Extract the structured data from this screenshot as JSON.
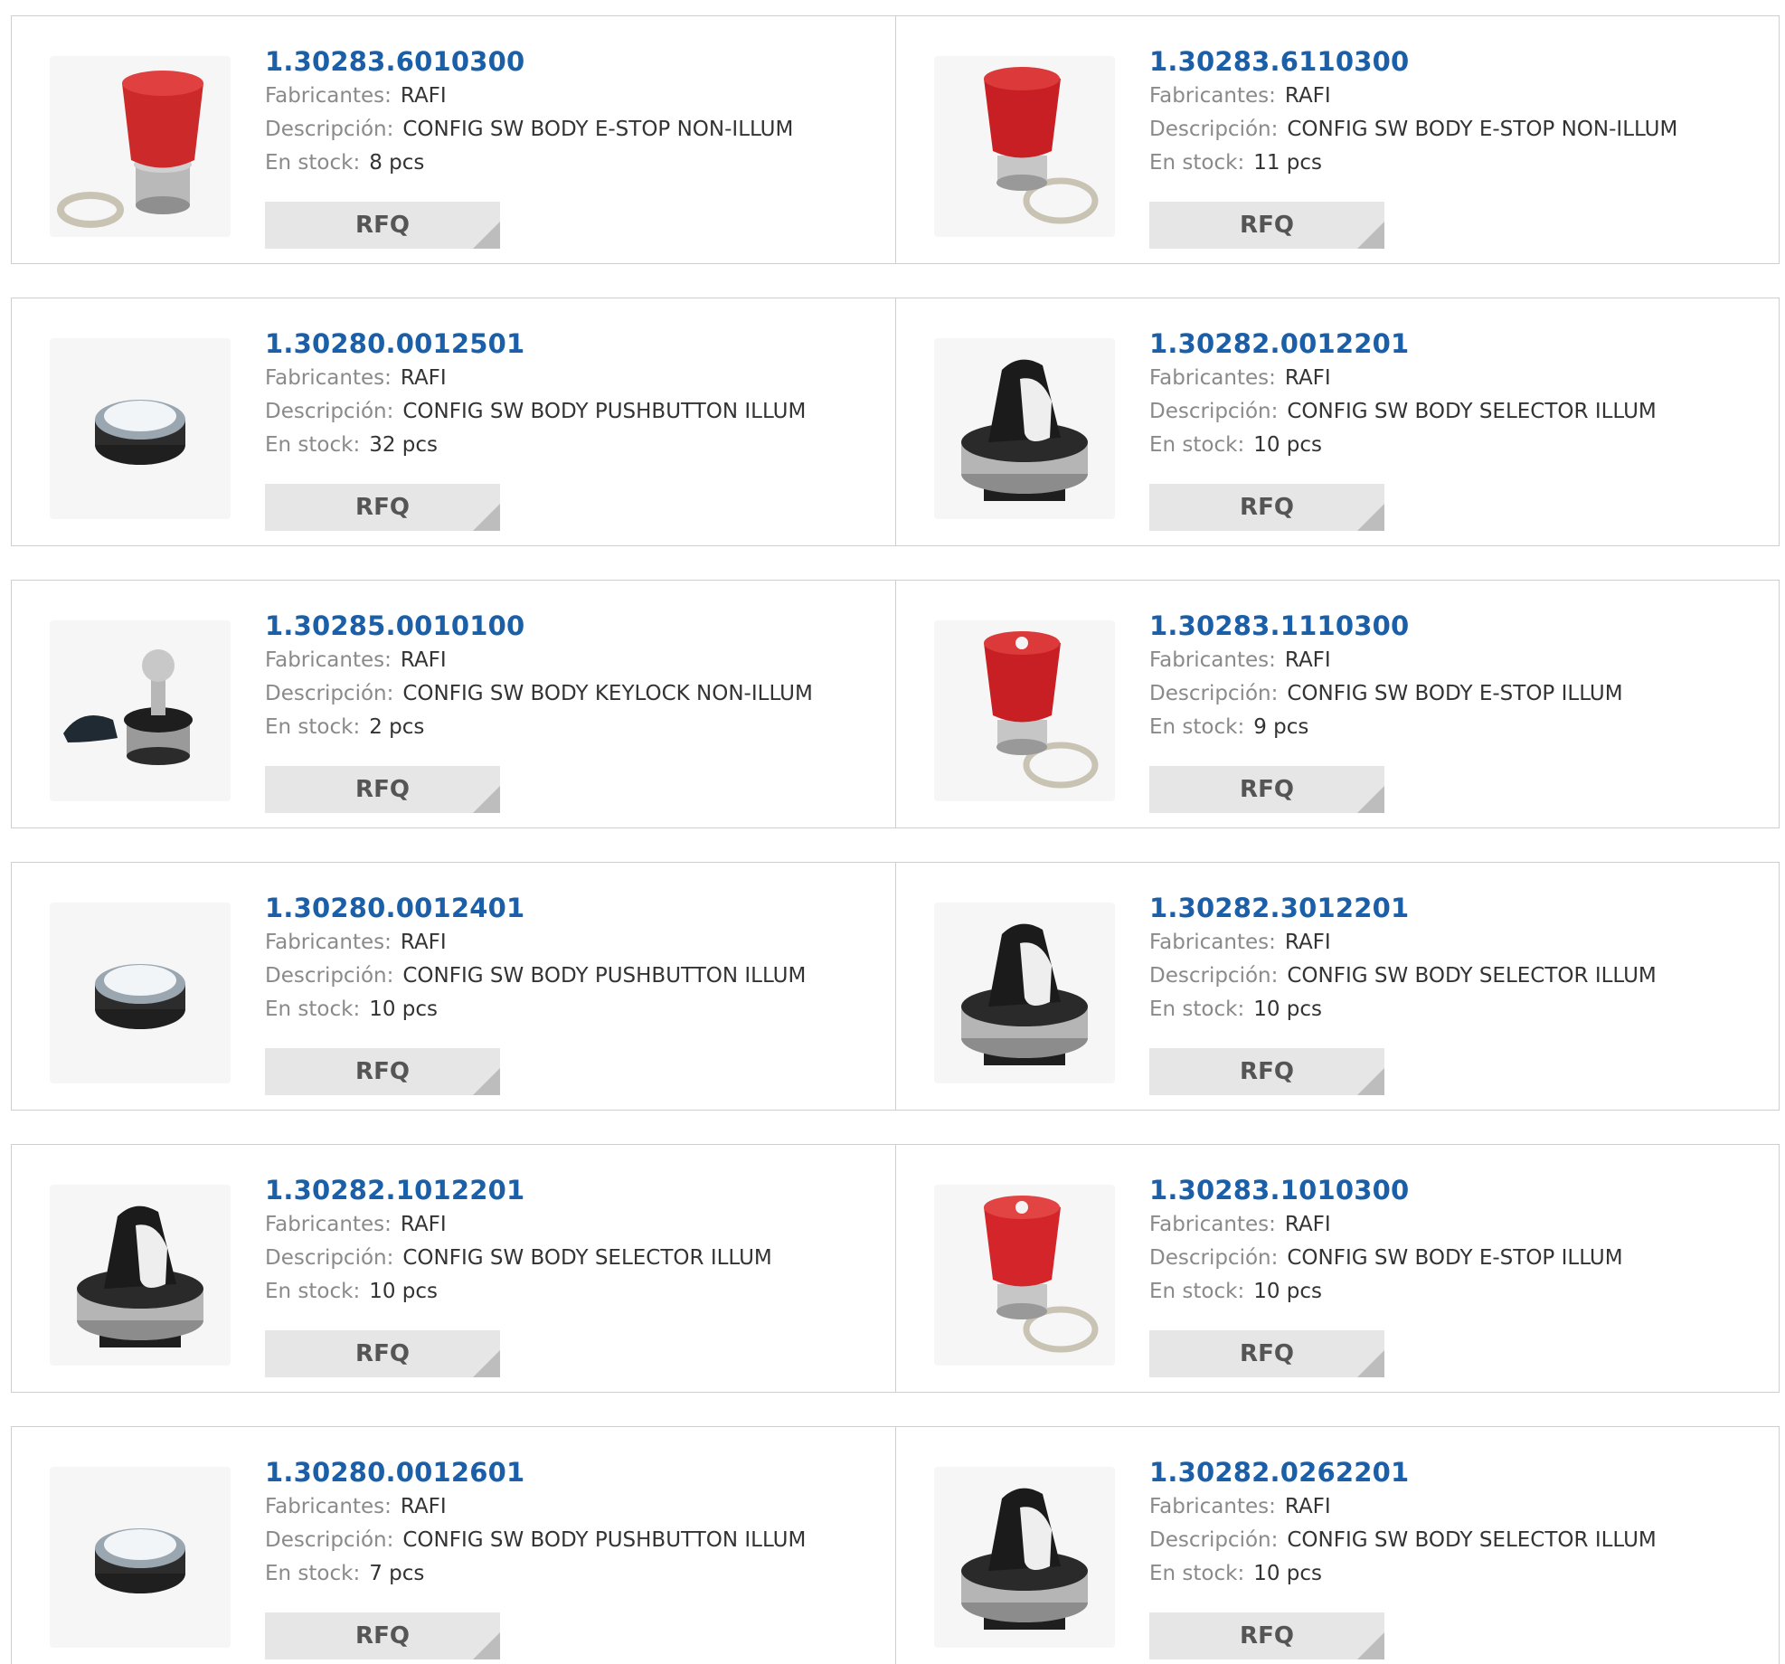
{
  "labels": {
    "manufacturer": "Fabricantes:",
    "description": "Descripción:",
    "stock": "En stock:",
    "rfq": "RFQ"
  },
  "products": [
    {
      "part": "1.30283.6010300",
      "manufacturer": "RAFI",
      "description": "CONFIG SW BODY E-STOP NON-ILLUM",
      "stock": "8 pcs",
      "image": "red-estop-button-icon"
    },
    {
      "part": "1.30283.6110300",
      "manufacturer": "RAFI",
      "description": "CONFIG SW BODY E-STOP NON-ILLUM",
      "stock": "11 pcs",
      "image": "red-estop-button-icon"
    },
    {
      "part": "1.30280.0012501",
      "manufacturer": "RAFI",
      "description": "CONFIG SW BODY PUSHBUTTON ILLUM",
      "stock": "32 pcs",
      "image": "pushbutton-icon"
    },
    {
      "part": "1.30282.0012201",
      "manufacturer": "RAFI",
      "description": "CONFIG SW BODY SELECTOR ILLUM",
      "stock": "10 pcs",
      "image": "selector-switch-icon"
    },
    {
      "part": "1.30285.0010100",
      "manufacturer": "RAFI",
      "description": "CONFIG SW BODY KEYLOCK NON-ILLUM",
      "stock": "2 pcs",
      "image": "keylock-switch-icon"
    },
    {
      "part": "1.30283.1110300",
      "manufacturer": "RAFI",
      "description": "CONFIG SW BODY E-STOP ILLUM",
      "stock": "9 pcs",
      "image": "red-estop-button-icon"
    },
    {
      "part": "1.30280.0012401",
      "manufacturer": "RAFI",
      "description": "CONFIG SW BODY PUSHBUTTON ILLUM",
      "stock": "10 pcs",
      "image": "pushbutton-icon"
    },
    {
      "part": "1.30282.3012201",
      "manufacturer": "RAFI",
      "description": "CONFIG SW BODY SELECTOR ILLUM",
      "stock": "10 pcs",
      "image": "selector-switch-icon"
    },
    {
      "part": "1.30282.1012201",
      "manufacturer": "RAFI",
      "description": "CONFIG SW BODY SELECTOR ILLUM",
      "stock": "10 pcs",
      "image": "selector-switch-icon"
    },
    {
      "part": "1.30283.1010300",
      "manufacturer": "RAFI",
      "description": "CONFIG SW BODY E-STOP ILLUM",
      "stock": "10 pcs",
      "image": "red-estop-button-icon"
    },
    {
      "part": "1.30280.0012601",
      "manufacturer": "RAFI",
      "description": "CONFIG SW BODY PUSHBUTTON ILLUM",
      "stock": "7 pcs",
      "image": "pushbutton-icon"
    },
    {
      "part": "1.30282.0262201",
      "manufacturer": "RAFI",
      "description": "CONFIG SW BODY SELECTOR ILLUM",
      "stock": "10 pcs",
      "image": "selector-switch-icon"
    }
  ],
  "colors": {
    "link": "#1a5fa8",
    "label": "#8a8a8a",
    "value": "#333333",
    "button": "#e6e6e6"
  }
}
